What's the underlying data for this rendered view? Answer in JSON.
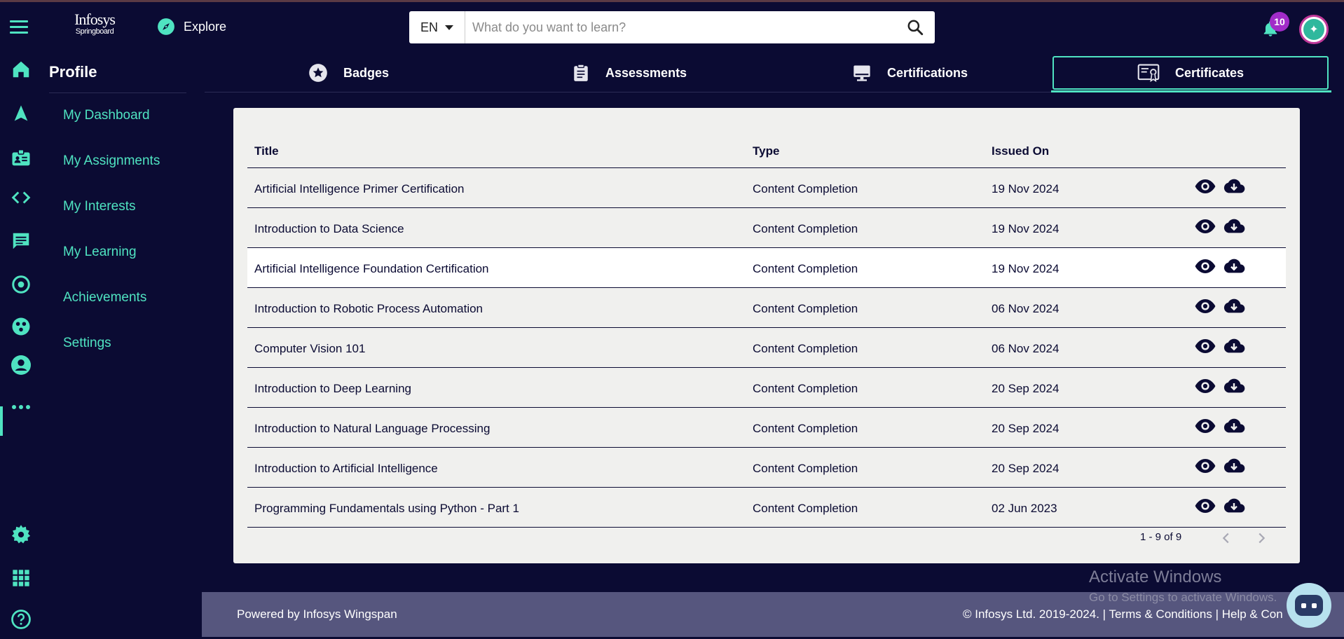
{
  "header": {
    "logo_line1": "Infosys",
    "logo_line2": "Springboard",
    "explore_label": "Explore",
    "language": "EN",
    "search_placeholder": "What do you want to learn?",
    "notification_count": "10"
  },
  "profile": {
    "title": "Profile",
    "nav": [
      {
        "label": "My Dashboard"
      },
      {
        "label": "My Assignments"
      },
      {
        "label": "My Interests"
      },
      {
        "label": "My Learning"
      },
      {
        "label": "Achievements"
      },
      {
        "label": "Settings"
      }
    ]
  },
  "tabs": [
    {
      "label": "Badges"
    },
    {
      "label": "Assessments"
    },
    {
      "label": "Certifications"
    },
    {
      "label": "Certificates",
      "active": true
    }
  ],
  "table": {
    "headers": {
      "title": "Title",
      "type": "Type",
      "issued_on": "Issued On"
    },
    "rows": [
      {
        "title": "Artificial Intelligence Primer Certification",
        "type": "Content Completion",
        "issued_on": "19 Nov 2024"
      },
      {
        "title": "Introduction to Data Science",
        "type": "Content Completion",
        "issued_on": "19 Nov 2024"
      },
      {
        "title": "Artificial Intelligence Foundation Certification",
        "type": "Content Completion",
        "issued_on": "19 Nov 2024"
      },
      {
        "title": "Introduction to Robotic Process Automation",
        "type": "Content Completion",
        "issued_on": "06 Nov 2024"
      },
      {
        "title": "Computer Vision 101",
        "type": "Content Completion",
        "issued_on": "06 Nov 2024"
      },
      {
        "title": "Introduction to Deep Learning",
        "type": "Content Completion",
        "issued_on": "20 Sep 2024"
      },
      {
        "title": "Introduction to Natural Language Processing",
        "type": "Content Completion",
        "issued_on": "20 Sep 2024"
      },
      {
        "title": "Introduction to Artificial Intelligence",
        "type": "Content Completion",
        "issued_on": "20 Sep 2024"
      },
      {
        "title": "Programming Fundamentals using Python - Part 1",
        "type": "Content Completion",
        "issued_on": "02 Jun 2023"
      }
    ],
    "pagination": "1 - 9 of 9"
  },
  "footer": {
    "powered_by": "Powered by Infosys Wingspan",
    "right_text": "© Infosys Ltd. 2019-2024. | Terms & Conditions | Help & Con"
  },
  "watermark": {
    "line1": "Activate Windows",
    "line2": "Go to Settings to activate Windows."
  },
  "colors": {
    "background": "#0b0b33",
    "accent": "#4fe3c1",
    "card": "#f0f0ee",
    "footer": "#56567e",
    "badge": "#a12cc8"
  },
  "icons": {
    "rail": [
      "home-icon",
      "navigation-icon",
      "badge-id-icon",
      "code-icon",
      "chat-icon",
      "target-icon",
      "community-icon",
      "account-icon",
      "more-icon",
      "settings-icon",
      "apps-grid-icon",
      "help-icon"
    ],
    "tabs": [
      "star-badge-icon",
      "clipboard-icon",
      "monitor-icon",
      "certificate-icon"
    ],
    "row_actions": [
      "eye-icon",
      "cloud-download-icon"
    ]
  }
}
